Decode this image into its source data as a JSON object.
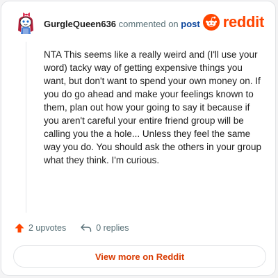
{
  "comment": {
    "username": "GurgleQueen636",
    "action": "commented on",
    "target": "post",
    "body": "NTA This seems like a really weird and (I'll use your word) tacky way of getting expensive things you want, but don't want to spend your own money on. If you do go ahead and make your feelings known to them, plan out how your going to say it because if you aren't careful your entire friend group will be calling you the a hole... Unless they feel the same way you do. You should ask the others in your group what they think. I'm curious."
  },
  "brand": {
    "name": "reddit",
    "icon": "reddit-logo-icon",
    "color": "#ff4500"
  },
  "stats": {
    "upvotes": "2 upvotes",
    "upvote_icon": "upvote-arrow-icon",
    "replies": "0 replies",
    "reply_icon": "reply-arrow-icon"
  },
  "cta": {
    "label": "View more on Reddit"
  },
  "colors": {
    "accent": "#ff4500",
    "username": "#1c1c1c",
    "link": "#0a449b",
    "muted": "#576f76",
    "cta_text": "#d93a00"
  }
}
